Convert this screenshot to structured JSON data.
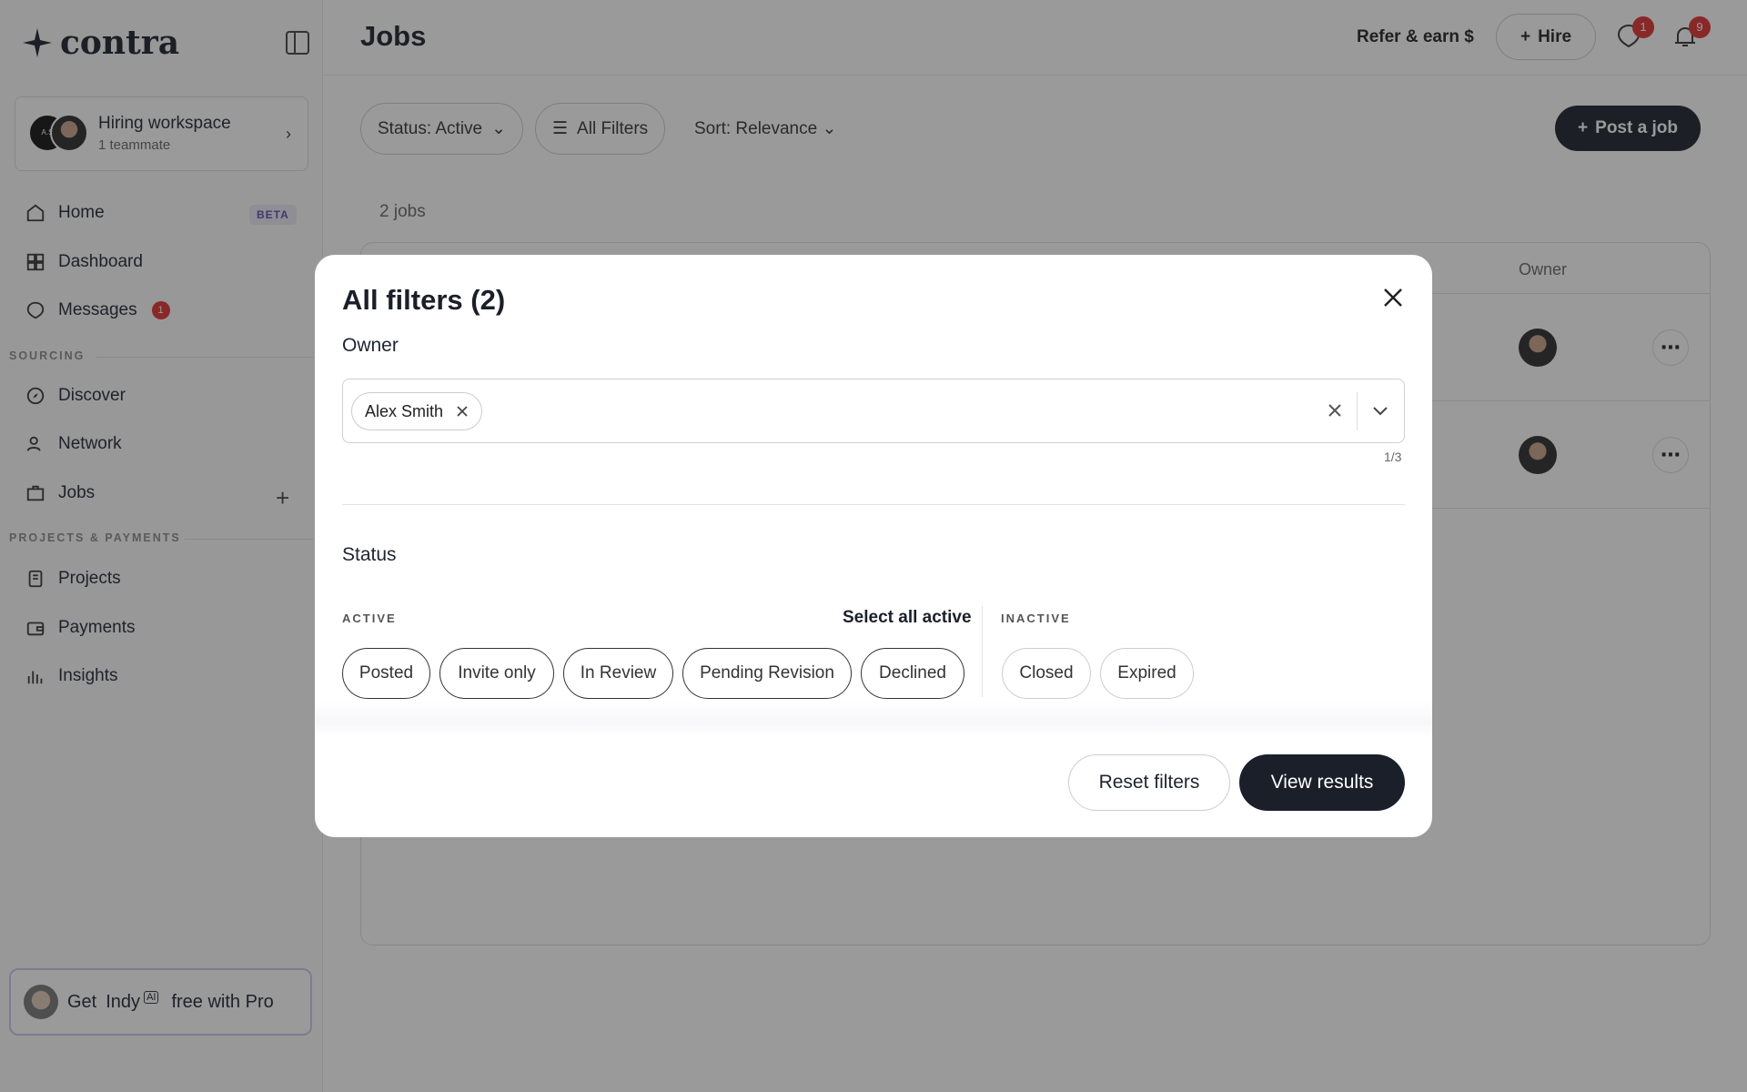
{
  "brand": {
    "name": "contra"
  },
  "workspace": {
    "name": "Hiring workspace",
    "subtitle": "1 teammate",
    "avatar_text": "A.S"
  },
  "sidebar": {
    "items": [
      {
        "label": "Home",
        "icon": "home-icon"
      },
      {
        "label": "Dashboard",
        "icon": "dashboard-icon"
      },
      {
        "label": "Messages",
        "icon": "messages-icon",
        "badge": "1"
      },
      {
        "label": "Discover",
        "icon": "compass-icon"
      },
      {
        "label": "Network",
        "icon": "users-icon"
      },
      {
        "label": "Jobs",
        "icon": "briefcase-icon"
      },
      {
        "label": "Projects",
        "icon": "projects-icon"
      },
      {
        "label": "Payments",
        "icon": "wallet-icon"
      },
      {
        "label": "Insights",
        "icon": "chart-icon"
      }
    ],
    "home_badge": "BETA",
    "sections": {
      "sourcing": "SOURCING",
      "projects_payments": "PROJECTS & PAYMENTS"
    },
    "promo": {
      "prefix": "Get",
      "name": "Indy",
      "ai_tag": "AI",
      "suffix": "free with Pro"
    }
  },
  "header": {
    "title": "Jobs",
    "refer_label": "Refer & earn $",
    "hire_label": "Hire",
    "messages_badge": "1",
    "notifications_badge": "9"
  },
  "toolbar": {
    "status_filter": "Status: Active",
    "all_filters": "All Filters",
    "sort": "Sort: Relevance",
    "post_job": "Post a job"
  },
  "jobs": {
    "count_label": "2 jobs",
    "owner_header": "Owner"
  },
  "modal": {
    "title": "All filters (2)",
    "owner_section": "Owner",
    "owner_chip": "Alex Smith",
    "owner_count": "1/3",
    "status_section": "Status",
    "active_label": "ACTIVE",
    "select_all_active": "Select all active",
    "inactive_label": "INACTIVE",
    "active_statuses": [
      "Posted",
      "Invite only",
      "In Review",
      "Pending Revision",
      "Declined"
    ],
    "inactive_statuses": [
      "Closed",
      "Expired"
    ],
    "reset_label": "Reset filters",
    "view_label": "View results"
  },
  "colors": {
    "primary_dark": "#1b1f2a",
    "badge_red": "#e03131",
    "beta_purple": "#5a4fa8"
  }
}
